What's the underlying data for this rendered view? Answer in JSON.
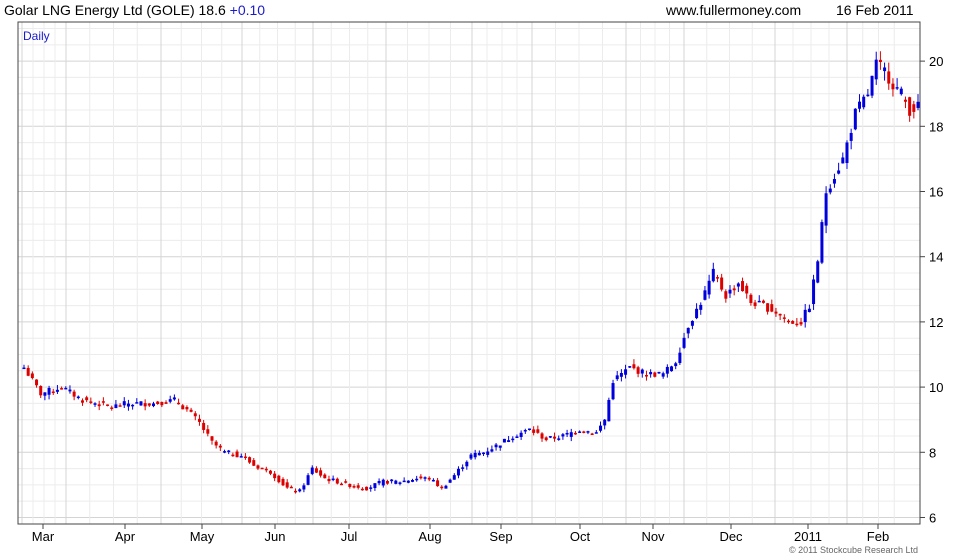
{
  "header": {
    "title": "Golar LNG Energy Ltd (GOLE) 18.6",
    "change": "+0.10",
    "site": "www.fullermoney.com",
    "date": "16 Feb 2011"
  },
  "footer": {
    "credit": "© 2011 Stockcube Research Ltd"
  },
  "colors": {
    "up": "#0000dd",
    "down": "#dd0000",
    "grid": "#d4d4d4",
    "frame": "#444444",
    "label": "#1a1acc"
  },
  "chart_data": {
    "type": "candlestick",
    "period_label": "Daily",
    "ylim": [
      5.8,
      21.2
    ],
    "y_ticks": [
      "6",
      "8",
      "10",
      "12",
      "14",
      "16",
      "18",
      "20"
    ],
    "x_ticks": [
      "Mar",
      "Apr",
      "May",
      "Jun",
      "Jul",
      "Aug",
      "Sep",
      "Oct",
      "Nov",
      "Dec",
      "2011",
      "Feb"
    ],
    "close_points": [
      [
        0,
        10.6
      ],
      [
        4,
        9.8
      ],
      [
        9,
        10.0
      ],
      [
        14,
        9.6
      ],
      [
        21,
        9.4
      ],
      [
        25,
        9.5
      ],
      [
        31,
        9.5
      ],
      [
        36,
        9.6
      ],
      [
        39,
        9.3
      ],
      [
        42,
        8.9
      ],
      [
        45,
        8.3
      ],
      [
        48,
        8.0
      ],
      [
        52,
        7.9
      ],
      [
        55,
        7.6
      ],
      [
        59,
        7.4
      ],
      [
        63,
        6.9
      ],
      [
        66,
        6.8
      ],
      [
        69,
        7.5
      ],
      [
        72,
        7.2
      ],
      [
        75,
        7.1
      ],
      [
        78,
        7.0
      ],
      [
        82,
        6.9
      ],
      [
        86,
        7.1
      ],
      [
        90,
        7.1
      ],
      [
        94,
        7.2
      ],
      [
        97,
        7.2
      ],
      [
        100,
        6.9
      ],
      [
        103,
        7.3
      ],
      [
        107,
        7.9
      ],
      [
        110,
        8.0
      ],
      [
        113,
        8.2
      ],
      [
        117,
        8.5
      ],
      [
        121,
        8.7
      ],
      [
        125,
        8.4
      ],
      [
        129,
        8.5
      ],
      [
        133,
        8.7
      ],
      [
        137,
        8.6
      ],
      [
        139,
        9.0
      ],
      [
        141,
        10.2
      ],
      [
        145,
        10.6
      ],
      [
        149,
        10.4
      ],
      [
        153,
        10.4
      ],
      [
        156,
        10.8
      ],
      [
        159,
        11.9
      ],
      [
        162,
        12.6
      ],
      [
        165,
        13.5
      ],
      [
        168,
        12.8
      ],
      [
        171,
        13.2
      ],
      [
        174,
        12.6
      ],
      [
        177,
        12.5
      ],
      [
        180,
        12.3
      ],
      [
        183,
        12.0
      ],
      [
        186,
        12.0
      ],
      [
        188,
        12.5
      ],
      [
        190,
        13.9
      ],
      [
        192,
        16.0
      ],
      [
        194,
        16.5
      ],
      [
        196,
        17.0
      ],
      [
        199,
        18.4
      ],
      [
        202,
        19.0
      ],
      [
        204,
        19.9
      ],
      [
        206,
        19.7
      ],
      [
        208,
        19.3
      ],
      [
        210,
        19.0
      ],
      [
        212,
        18.5
      ],
      [
        214,
        18.6
      ]
    ]
  }
}
